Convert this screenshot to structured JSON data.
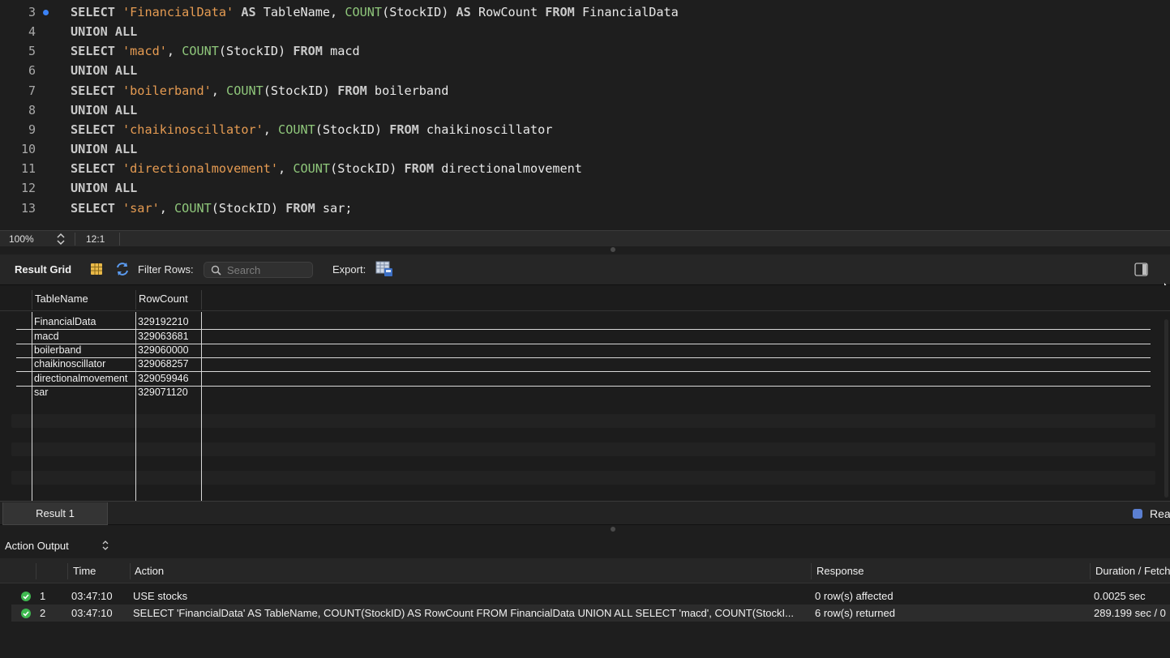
{
  "editor": {
    "lines": [
      {
        "num": "3",
        "tokens": [
          [
            "kw",
            "SELECT "
          ],
          [
            "str",
            "'FinancialData'"
          ],
          [
            "kw",
            " AS "
          ],
          [
            "id",
            "TableName, "
          ],
          [
            "fn",
            "COUNT"
          ],
          [
            "id",
            "(StockID) "
          ],
          [
            "kw",
            "AS "
          ],
          [
            "id",
            "RowCount "
          ],
          [
            "kw",
            "FROM "
          ],
          [
            "id",
            "FinancialData"
          ]
        ]
      },
      {
        "num": "4",
        "tokens": [
          [
            "kw",
            "UNION ALL"
          ]
        ]
      },
      {
        "num": "5",
        "tokens": [
          [
            "kw",
            "SELECT "
          ],
          [
            "str",
            "'macd'"
          ],
          [
            "id",
            ", "
          ],
          [
            "fn",
            "COUNT"
          ],
          [
            "id",
            "(StockID) "
          ],
          [
            "kw",
            "FROM "
          ],
          [
            "id",
            "macd"
          ]
        ]
      },
      {
        "num": "6",
        "tokens": [
          [
            "kw",
            "UNION ALL"
          ]
        ]
      },
      {
        "num": "7",
        "tokens": [
          [
            "kw",
            "SELECT "
          ],
          [
            "str",
            "'boilerband'"
          ],
          [
            "id",
            ", "
          ],
          [
            "fn",
            "COUNT"
          ],
          [
            "id",
            "(StockID) "
          ],
          [
            "kw",
            "FROM "
          ],
          [
            "id",
            "boilerband"
          ]
        ]
      },
      {
        "num": "8",
        "tokens": [
          [
            "kw",
            "UNION ALL"
          ]
        ]
      },
      {
        "num": "9",
        "tokens": [
          [
            "kw",
            "SELECT "
          ],
          [
            "str",
            "'chaikinoscillator'"
          ],
          [
            "id",
            ", "
          ],
          [
            "fn",
            "COUNT"
          ],
          [
            "id",
            "(StockID) "
          ],
          [
            "kw",
            "FROM "
          ],
          [
            "id",
            "chaikinoscillator"
          ]
        ]
      },
      {
        "num": "10",
        "tokens": [
          [
            "kw",
            "UNION ALL"
          ]
        ]
      },
      {
        "num": "11",
        "tokens": [
          [
            "kw",
            "SELECT "
          ],
          [
            "str",
            "'directionalmovement'"
          ],
          [
            "id",
            ", "
          ],
          [
            "fn",
            "COUNT"
          ],
          [
            "id",
            "(StockID) "
          ],
          [
            "kw",
            "FROM "
          ],
          [
            "id",
            "directionalmovement"
          ]
        ]
      },
      {
        "num": "12",
        "tokens": [
          [
            "kw",
            "UNION ALL"
          ]
        ]
      },
      {
        "num": "13",
        "tokens": [
          [
            "kw",
            "SELECT "
          ],
          [
            "str",
            "'sar'"
          ],
          [
            "id",
            ", "
          ],
          [
            "fn",
            "COUNT"
          ],
          [
            "id",
            "(StockID) "
          ],
          [
            "kw",
            "FROM "
          ],
          [
            "id",
            "sar;"
          ]
        ]
      }
    ]
  },
  "statusbar": {
    "zoom": "100%",
    "cursor": "12:1"
  },
  "result_toolbar": {
    "title": "Result Grid",
    "filter_label": "Filter Rows:",
    "search_placeholder": "Search",
    "export_label": "Export:"
  },
  "result_grid": {
    "columns": [
      "TableName",
      "RowCount"
    ],
    "rows": [
      [
        "FinancialData",
        "329192210"
      ],
      [
        "macd",
        "329063681"
      ],
      [
        "boilerband",
        "329060000"
      ],
      [
        "chaikinoscillator",
        "329068257"
      ],
      [
        "directionalmovement",
        "329059946"
      ],
      [
        "sar",
        "329071120"
      ]
    ]
  },
  "result_tabs": {
    "active_tab": "Result 1",
    "readonly_text": "Rea"
  },
  "action_output": {
    "title": "Action Output",
    "columns": [
      "Time",
      "Action",
      "Response",
      "Duration / Fetch"
    ],
    "rows": [
      {
        "index": "1",
        "time": "03:47:10",
        "action": "USE stocks",
        "response": "0 row(s) affected",
        "duration": "0.0025 sec"
      },
      {
        "index": "2",
        "time": "03:47:10",
        "action": "SELECT 'FinancialData' AS TableName, COUNT(StockID) AS RowCount FROM FinancialData UNION ALL SELECT 'macd', COUNT(StockI...",
        "response": "6 row(s) returned",
        "duration": "289.199 sec / 0"
      }
    ]
  },
  "colors": {
    "keyword": "#c9c9c9",
    "string": "#e59b52",
    "function": "#8fc77b",
    "success": "#3fb950",
    "accent": "#3b82f6"
  },
  "icons": [
    "breakpoint-dot",
    "zoom-stepper-icon",
    "grid-icon",
    "refresh-icon",
    "search-icon",
    "export-icon",
    "panel-toggle-icon",
    "readonly-icon",
    "success-check-icon",
    "select-arrows-icon"
  ]
}
